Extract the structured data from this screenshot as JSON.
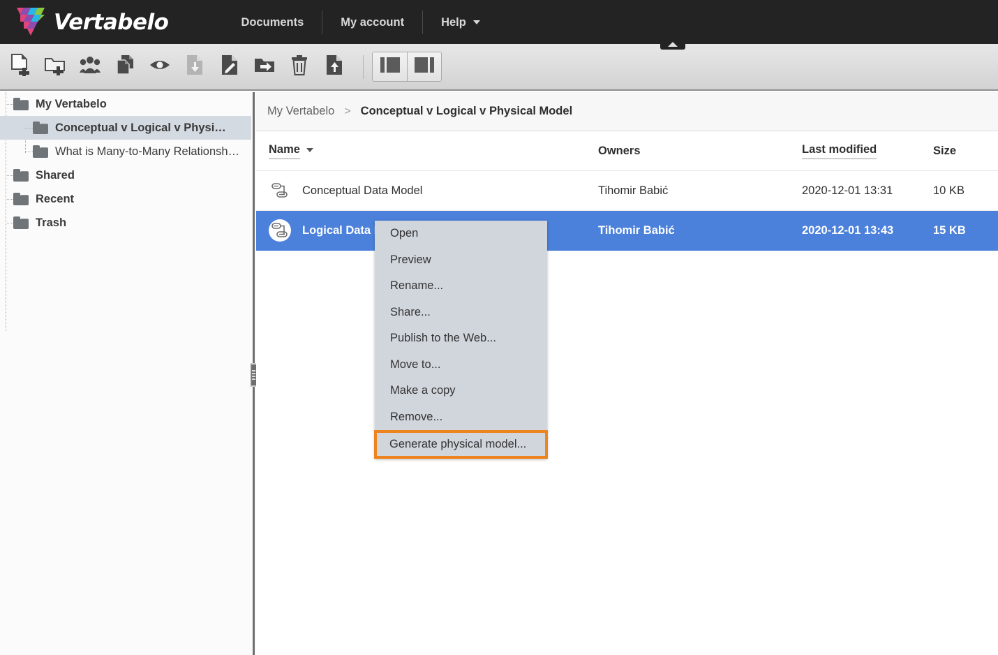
{
  "app": {
    "brand": "Vertabelo",
    "logo_icon": "vertabelo-triangle-logo",
    "nav": [
      {
        "label": "Documents",
        "icon": ""
      },
      {
        "label": "My account",
        "icon": ""
      },
      {
        "label": "Help",
        "icon": "chevron-down-icon"
      }
    ]
  },
  "toolbar": {
    "collapse_tab_icon": "triangle-up-icon",
    "buttons": [
      {
        "name": "new-document-button",
        "icon": "document-plus-icon",
        "enabled": true
      },
      {
        "name": "new-folder-button",
        "icon": "folder-plus-icon",
        "enabled": true
      },
      {
        "name": "share-button",
        "icon": "people-icon",
        "enabled": true
      },
      {
        "name": "copy-button",
        "icon": "copy-documents-icon",
        "enabled": true
      },
      {
        "name": "preview-button",
        "icon": "eye-icon",
        "enabled": true
      },
      {
        "name": "download-button",
        "icon": "document-download-icon",
        "enabled": false
      },
      {
        "name": "rename-button",
        "icon": "document-pencil-icon",
        "enabled": true
      },
      {
        "name": "move-to-folder-button",
        "icon": "folder-arrow-icon",
        "enabled": true
      },
      {
        "name": "delete-button",
        "icon": "trash-icon",
        "enabled": true
      },
      {
        "name": "upload-button",
        "icon": "document-upload-icon",
        "enabled": true
      }
    ],
    "view_buttons": [
      {
        "name": "view-list-left-button",
        "icon": "panel-left-icon"
      },
      {
        "name": "view-list-right-button",
        "icon": "panel-right-icon"
      }
    ]
  },
  "sidebar": {
    "items": [
      {
        "label": "My Vertabelo",
        "icon": "folder-icon",
        "depth": 0,
        "bold": true,
        "selected": false
      },
      {
        "label": "Conceptual v Logical v Physi…",
        "icon": "folder-icon",
        "depth": 1,
        "bold": true,
        "selected": true
      },
      {
        "label": "What is Many-to-Many Relationshi…",
        "icon": "folder-icon",
        "depth": 1,
        "bold": false,
        "selected": false
      },
      {
        "label": "Shared",
        "icon": "folder-icon",
        "depth": 0,
        "bold": true,
        "selected": false
      },
      {
        "label": "Recent",
        "icon": "folder-icon",
        "depth": 0,
        "bold": true,
        "selected": false
      },
      {
        "label": "Trash",
        "icon": "folder-icon",
        "depth": 0,
        "bold": true,
        "selected": false
      }
    ]
  },
  "splitter": {
    "name": "sidebar-splitter",
    "icon": "drag-grip-icon"
  },
  "breadcrumb": {
    "root": "My Vertabelo",
    "separator": ">",
    "current": "Conceptual v Logical v Physical Model"
  },
  "table": {
    "columns": [
      {
        "label": "Name",
        "underlined": true,
        "sorted": true,
        "sort_icon": "sort-desc-arrow-icon"
      },
      {
        "label": "Owners",
        "underlined": false,
        "sorted": false,
        "sort_icon": ""
      },
      {
        "label": "Last modified",
        "underlined": true,
        "sorted": false,
        "sort_icon": ""
      },
      {
        "label": "Size",
        "underlined": false,
        "sorted": false,
        "sort_icon": ""
      }
    ],
    "rows": [
      {
        "icon": "data-model-icon",
        "name": "Conceptual Data Model",
        "owner": "Tihomir Babić",
        "modified": "2020-12-01 13:31",
        "size": "10 KB",
        "selected": false
      },
      {
        "icon": "data-model-icon",
        "name": "Logical Data Model",
        "owner": "Tihomir Babić",
        "modified": "2020-12-01 13:43",
        "size": "15 KB",
        "selected": true
      }
    ]
  },
  "context_menu": {
    "items": [
      {
        "label": "Open",
        "highlighted": false
      },
      {
        "label": "Preview",
        "highlighted": false
      },
      {
        "label": "Rename...",
        "highlighted": false
      },
      {
        "label": "Share...",
        "highlighted": false
      },
      {
        "label": "Publish to the Web...",
        "highlighted": false
      },
      {
        "label": "Move to...",
        "highlighted": false
      },
      {
        "label": "Make a copy",
        "highlighted": false
      },
      {
        "label": "Remove...",
        "highlighted": false
      },
      {
        "label": "Generate physical model...",
        "highlighted": true
      }
    ]
  },
  "colors": {
    "topbar_bg": "#232323",
    "selection_blue": "#4b80db",
    "highlight_orange": "#ee8420",
    "menu_bg": "#d1d6dd",
    "sidebar_selected": "#d4dae1"
  }
}
